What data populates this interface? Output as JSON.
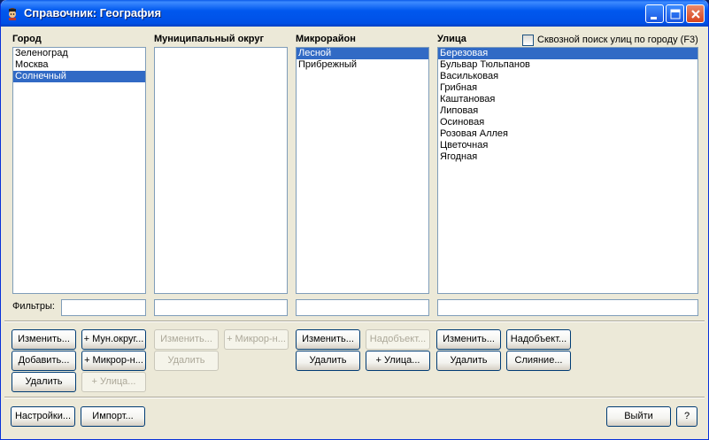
{
  "window": {
    "title": "Справочник: География"
  },
  "columns": {
    "city": {
      "label": "Город",
      "items": [
        "Зеленоград",
        "Москва",
        "Солнечный"
      ],
      "selected": 2
    },
    "district": {
      "label": "Муниципальный округ",
      "items": [],
      "selected": -1
    },
    "microdistrict": {
      "label": "Микрорайон",
      "items": [
        "Лесной",
        "Прибрежный"
      ],
      "selected": 0
    },
    "street": {
      "label": "Улица",
      "items": [
        "Березовая",
        "Бульвар Тюльпанов",
        "Васильковая",
        "Грибная",
        "Каштановая",
        "Липовая",
        "Осиновая",
        "Розовая Аллея",
        "Цветочная",
        "Ягодная"
      ],
      "selected": 0
    }
  },
  "through_search": {
    "label": "Сквозной поиск улиц по городу (F3)",
    "checked": false
  },
  "filters": {
    "label": "Фильтры:",
    "city": "",
    "district": "",
    "microdistrict": "",
    "street": ""
  },
  "buttons": {
    "city_edit": "Изменить...",
    "city_add": "Добавить...",
    "city_delete": "Удалить",
    "add_mun_okrug": "+ Мун.округ...",
    "add_mikror": "+ Микрор-н...",
    "add_ulica": "+ Улица...",
    "district_edit": "Изменить...",
    "district_delete": "Удалить",
    "district_add_mikror": "+ Микрор-н...",
    "micro_edit": "Изменить...",
    "micro_delete": "Удалить",
    "micro_nadobekt": "Надобъект...",
    "micro_add_ulica": "+ Улица...",
    "street_edit": "Изменить...",
    "street_delete": "Удалить",
    "street_nadobekt": "Надобъект...",
    "street_merge": "Слияние...",
    "settings": "Настройки...",
    "import": "Импорт...",
    "exit": "Выйти",
    "help": "?"
  },
  "icons": [
    "app-icon",
    "minimize-icon",
    "maximize-icon",
    "close-icon"
  ]
}
